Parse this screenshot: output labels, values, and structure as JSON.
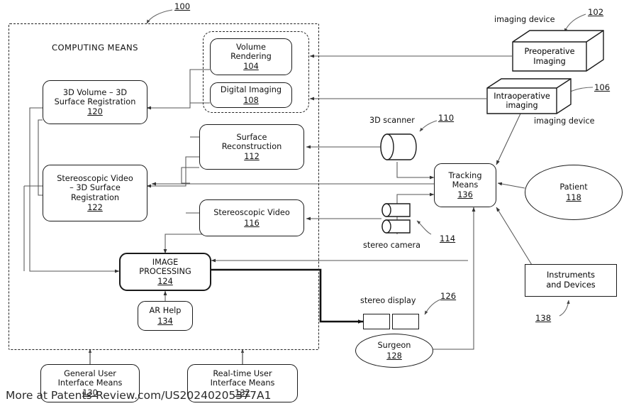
{
  "figure": {
    "system_ref": "100",
    "computing_means_title": "COMPUTING MEANS"
  },
  "computing_means": {
    "boxes": [
      {
        "id": "volume-rendering",
        "line1": "Volume",
        "line2": "Rendering",
        "line3": "",
        "ref": "104"
      },
      {
        "id": "digital-imaging",
        "line1": "Digital Imaging",
        "line2": "",
        "line3": "",
        "ref": "108"
      },
      {
        "id": "surface-reconstruction",
        "line1": "Surface",
        "line2": "Reconstruction",
        "line3": "",
        "ref": "112"
      },
      {
        "id": "stereoscopic-video",
        "line1": "Stereoscopic Video",
        "line2": "",
        "line3": "",
        "ref": "116"
      },
      {
        "id": "volume-surface-registration",
        "line1": "3D Volume – 3D",
        "line2": "Surface Registration",
        "line3": "",
        "ref": "120"
      },
      {
        "id": "video-surface-registration",
        "line1": "Stereoscopic Video",
        "line2": "– 3D Surface",
        "line3": "Registration",
        "ref": "122"
      },
      {
        "id": "image-processing",
        "line1": "IMAGE",
        "line2": "PROCESSING",
        "line3": "",
        "ref": "124"
      },
      {
        "id": "ar-help",
        "line1": "AR Help",
        "line2": "",
        "line3": "",
        "ref": "134"
      }
    ]
  },
  "external": {
    "preoperative_imaging": {
      "line1": "Preoperative",
      "line2": "Imaging",
      "ref": "102",
      "caption": "imaging device"
    },
    "intraoperative_imaging": {
      "line1": "Intraoperative",
      "line2": "imaging",
      "ref": "106",
      "caption": "imaging device"
    },
    "scanner_3d": {
      "label": "3D scanner",
      "ref": "110"
    },
    "stereo_camera": {
      "label": "stereo camera",
      "ref": "114"
    },
    "stereo_display": {
      "label": "stereo display",
      "ref": "126"
    },
    "tracking_means": {
      "line1": "Tracking",
      "line2": "Means",
      "ref": "136"
    },
    "patient": {
      "label": "Patient",
      "ref": "118"
    },
    "surgeon": {
      "label": "Surgeon",
      "ref": "128"
    },
    "instruments_and_devices": {
      "line1": "Instruments",
      "line2": "and Devices",
      "ref": "138"
    }
  },
  "user_interfaces": [
    {
      "id": "general-user-interface-means",
      "line1": "General User",
      "line2": "Interface Means",
      "ref": "130"
    },
    {
      "id": "realtime-user-interface-means",
      "line1": "Real-time User",
      "line2": "Interface Means",
      "ref": "132"
    }
  ],
  "watermark": {
    "text": "More at Patents-Review.com/US20240205377A1"
  },
  "colors": {
    "stroke": "#1a1a1a",
    "thin_stroke": "#555555",
    "background": "#ffffff"
  }
}
